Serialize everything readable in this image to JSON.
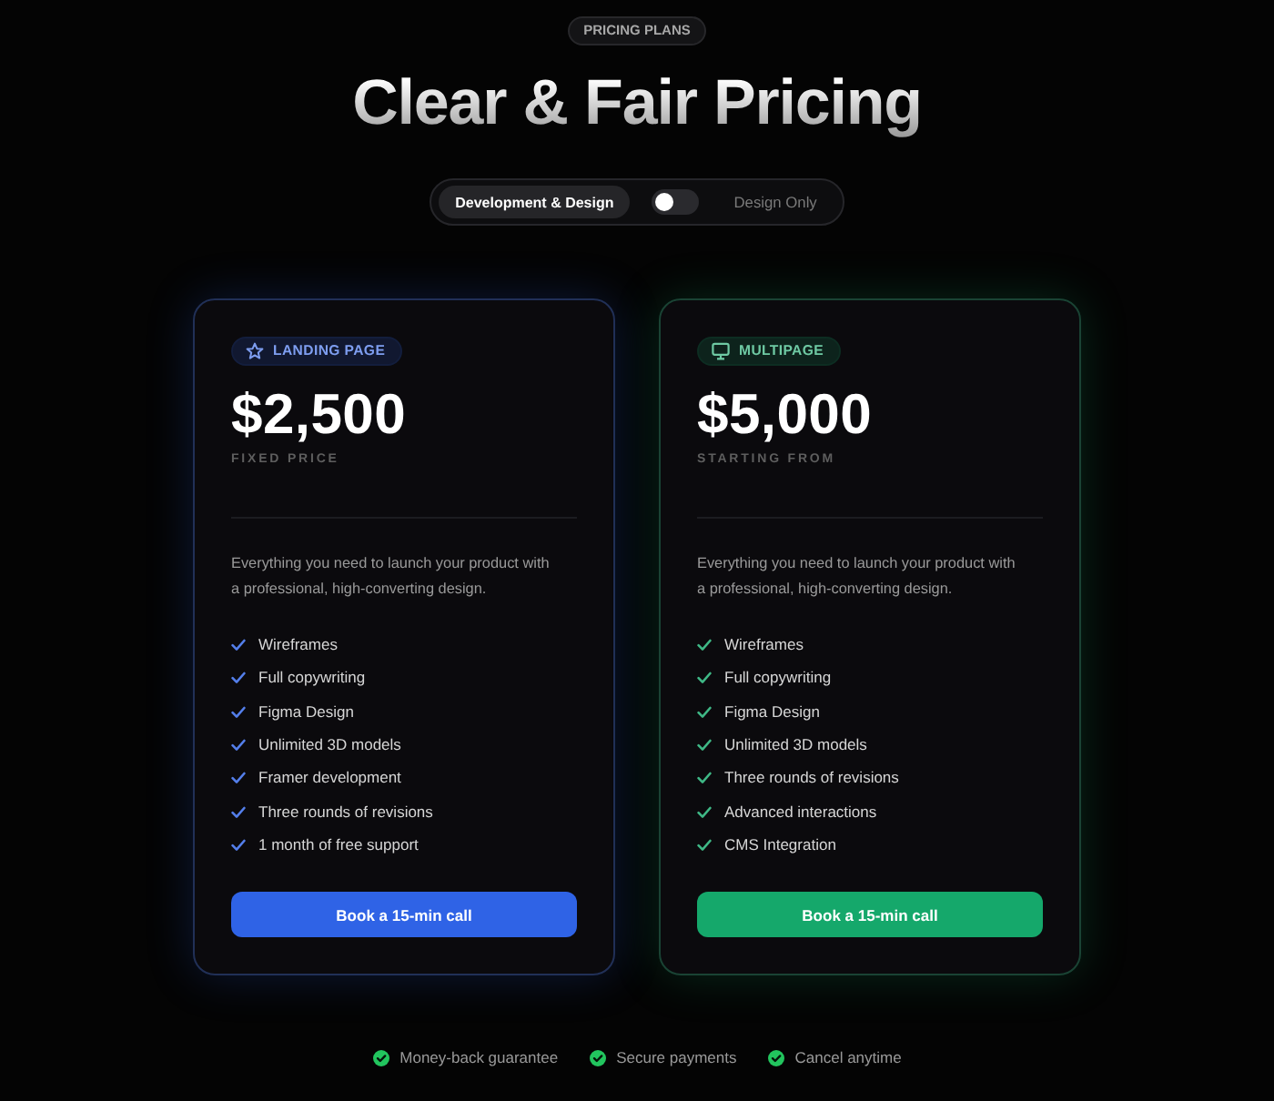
{
  "header": {
    "badge": "PRICING PLANS",
    "title": "Clear & Fair Pricing"
  },
  "billing_toggle": {
    "options": [
      {
        "label": "Development & Design",
        "selected": true
      },
      {
        "label": "Design Only",
        "selected": false
      }
    ],
    "switch_on": false
  },
  "plans": [
    {
      "badge": "LANDING PAGE",
      "color": "#2f63e6",
      "price": "$2,500",
      "price_note": "FIXED PRICE",
      "description": "Everything you need to launch your product with a professional, high-converting design.",
      "features": [
        "Wireframes",
        "Full copywriting",
        "Figma Design",
        "Unlimited 3D models",
        "Framer development",
        "Three rounds of revisions",
        "1 month of free support"
      ],
      "button": "Book a 15-min call"
    },
    {
      "badge": "MULTIPAGE",
      "color": "#15a86b",
      "price": "$5,000",
      "price_note": "STARTING FROM",
      "description": "Everything you need to launch your product with a professional, high-converting design.",
      "features": [
        "Wireframes",
        "Full copywriting",
        "Figma Design",
        "Unlimited 3D models",
        "Three rounds of revisions",
        "Advanced interactions",
        "CMS Integration"
      ],
      "button": "Book a 15-min call"
    }
  ],
  "guarantees": [
    "Money-back guarantee",
    "Secure payments",
    "Cancel anytime"
  ]
}
